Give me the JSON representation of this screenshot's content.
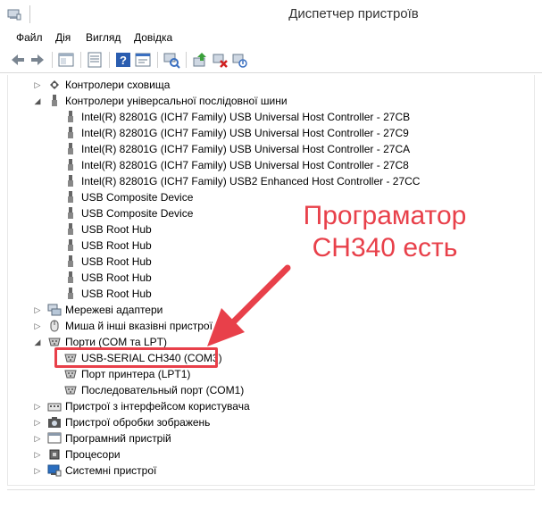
{
  "window": {
    "title": "Диспетчер пристроїв"
  },
  "menu": [
    "Файл",
    "Дія",
    "Вигляд",
    "Довідка"
  ],
  "toolbar": {
    "buttons": [
      "back-icon",
      "forward-icon",
      "properties-pane-icon",
      "show-hidden-icon",
      "help-icon",
      "properties-icon",
      "scan-hardware-icon",
      "update-driver-icon",
      "uninstall-icon",
      "disable-icon"
    ]
  },
  "tree": {
    "storage_controllers": "Контролери сховища",
    "usb_controllers": "Контролери універсальної послідовної шини",
    "usb_devices": [
      "Intel(R) 82801G (ICH7 Family) USB Universal Host Controller - 27CB",
      "Intel(R) 82801G (ICH7 Family) USB Universal Host Controller - 27C9",
      "Intel(R) 82801G (ICH7 Family) USB Universal Host Controller - 27CA",
      "Intel(R) 82801G (ICH7 Family) USB Universal Host Controller - 27C8",
      "Intel(R) 82801G (ICH7 Family) USB2 Enhanced Host Controller - 27CC",
      "USB Composite Device",
      "USB Composite Device",
      "USB Root Hub",
      "USB Root Hub",
      "USB Root Hub",
      "USB Root Hub",
      "USB Root Hub"
    ],
    "network_adapters": "Мережеві адаптери",
    "mice": "Миша й інші вказівні пристрої",
    "ports": "Порти (COM та LPT)",
    "port_devices": [
      "USB-SERIAL CH340 (COM3)",
      "Порт принтера (LPT1)",
      "Последовательный порт (COM1)"
    ],
    "hid": "Пристрої з інтерфейсом користувача",
    "imaging": "Пристрої обробки зображень",
    "software": "Програмний пристрій",
    "processors": "Процесори",
    "system": "Системні пристрої"
  },
  "annotation": {
    "line1": "Програматор",
    "line2": "CH340 есть"
  },
  "colors": {
    "accent": "#e8404a"
  }
}
